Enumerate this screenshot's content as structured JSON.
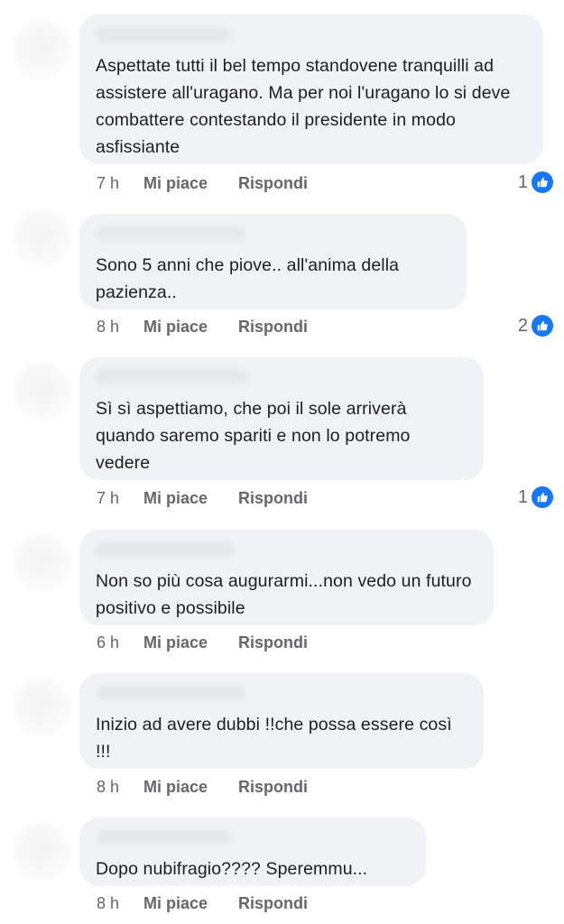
{
  "comments": [
    {
      "text": "Aspettate tutti il bel tempo standovene tranquilli ad assistere all'uragano. Ma per noi l'uragano lo si deve combattere contestando il presidente in modo asfissiante",
      "time": "7 h",
      "like_label": "Mi piace",
      "reply_label": "Rispondi",
      "reaction_count": "1"
    },
    {
      "text": "Sono 5 anni che piove.. all'anima della pazienza..",
      "time": "8 h",
      "like_label": "Mi piace",
      "reply_label": "Rispondi",
      "reaction_count": "2"
    },
    {
      "text": "Sì sì aspettiamo, che poi il sole arriverà quando saremo spariti e non lo potremo vedere",
      "time": "7 h",
      "like_label": "Mi piace",
      "reply_label": "Rispondi",
      "reaction_count": "1"
    },
    {
      "text": "Non so più cosa augurarmi...non vedo un futuro positivo e possibile",
      "time": "6 h",
      "like_label": "Mi piace",
      "reply_label": "Rispondi"
    },
    {
      "text": "Inizio ad avere dubbi !!che possa essere così !!!",
      "time": "8 h",
      "like_label": "Mi piace",
      "reply_label": "Rispondi"
    },
    {
      "text": "Dopo nubifragio???? Speremmu...",
      "time": "8 h",
      "like_label": "Mi piace",
      "reply_label": "Rispondi"
    }
  ],
  "colors": {
    "bubble": "#f0f2f5",
    "text": "#1c1e21",
    "meta": "#65676b",
    "like_badge": "#1877f2"
  },
  "icons": {
    "reaction": "like-thumb-icon"
  }
}
